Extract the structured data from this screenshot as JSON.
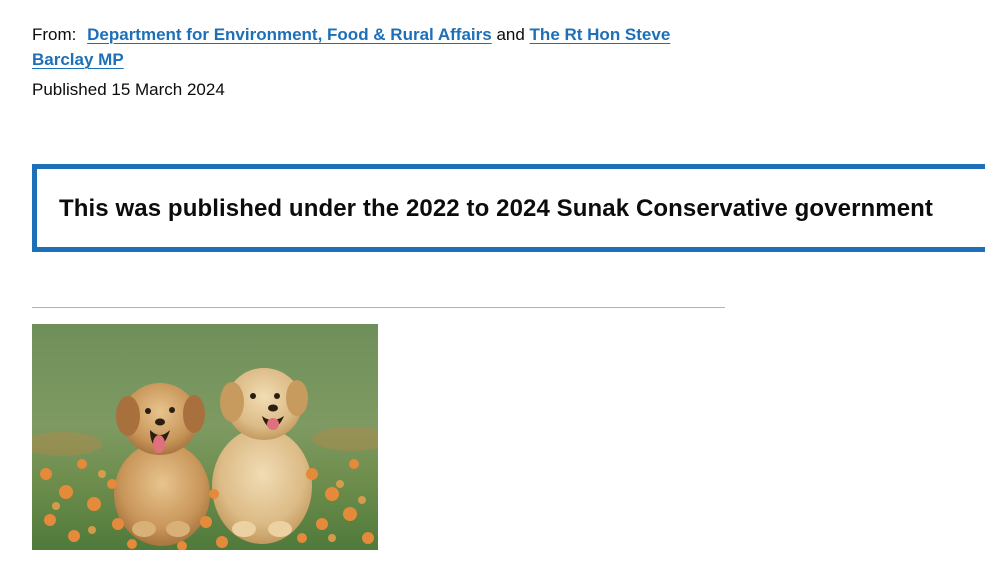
{
  "metadata": {
    "from_label": "From:",
    "organisations": [
      "Department for Environment, Food & Rural Affairs",
      "The Rt Hon Steve Barclay MP"
    ],
    "conjunction": "and",
    "published": "Published 15 March 2024"
  },
  "history_notice": {
    "text": "This was published under the 2022 to 2024 Sunak Conservative government",
    "accent_color": "#1d70b8"
  },
  "lead_image": {
    "subject": "two golden retriever puppies sitting among orange flowers on grass"
  },
  "colors": {
    "link": "#1d70b8",
    "text": "#0b0c0c",
    "divider": "#b1b4b6"
  }
}
